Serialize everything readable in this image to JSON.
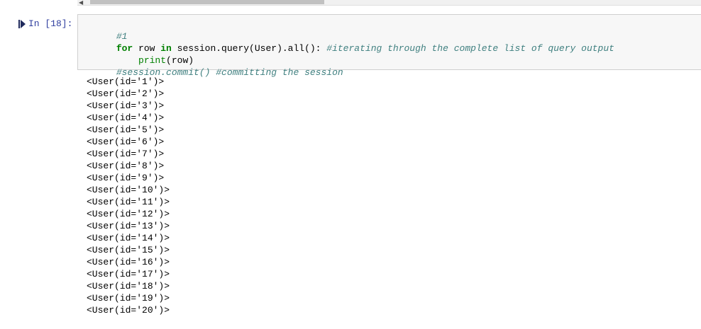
{
  "prompt": {
    "label": "In [18]:"
  },
  "code": {
    "line1_comment": "#1",
    "line2": {
      "kw_for": "for",
      "text_a": " row ",
      "kw_in": "in",
      "text_b": " session.query(User).all(): ",
      "comment": "#iterating through the complete list of query output"
    },
    "line3": {
      "indent": "    ",
      "builtin_print": "print",
      "text": "(row)"
    },
    "line4": {
      "comment_a": "#session.commit()",
      "space": " ",
      "comment_b": "#committing the session"
    }
  },
  "output": {
    "lines": [
      "<User(id='1')>",
      "<User(id='2')>",
      "<User(id='3')>",
      "<User(id='4')>",
      "<User(id='5')>",
      "<User(id='6')>",
      "<User(id='7')>",
      "<User(id='8')>",
      "<User(id='9')>",
      "<User(id='10')>",
      "<User(id='11')>",
      "<User(id='12')>",
      "<User(id='13')>",
      "<User(id='14')>",
      "<User(id='15')>",
      "<User(id='16')>",
      "<User(id='17')>",
      "<User(id='18')>",
      "<User(id='19')>",
      "<User(id='20')>"
    ]
  },
  "icons": {
    "run": "run-cell-icon",
    "scroll_left": "scroll-left-arrow-icon"
  },
  "colors": {
    "prompt": "#303f9f",
    "keyword": "#008000",
    "comment": "#408080",
    "input_bg": "#f7f7f7",
    "input_border": "#cfcfcf"
  }
}
